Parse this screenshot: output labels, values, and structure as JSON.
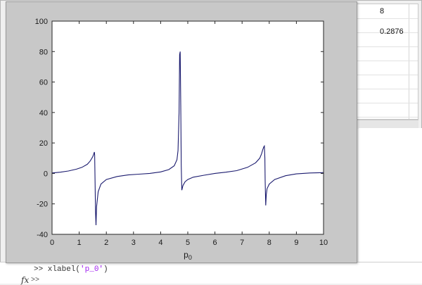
{
  "workspace": {
    "value_1": "8",
    "value_2": "0.2876"
  },
  "command_window": {
    "line_prefix": ">> xlabel(",
    "line_arg": "'p_0'",
    "line_suffix": ")",
    "fx_symbol": "fx",
    "prompt": ">>"
  },
  "chart_data": {
    "type": "line",
    "title": "",
    "xlabel_main": "p",
    "xlabel_sub": "0",
    "ylabel": "",
    "xlim": [
      0,
      10
    ],
    "ylim": [
      -40,
      100
    ],
    "xticks": [
      0,
      1,
      2,
      3,
      4,
      5,
      6,
      7,
      8,
      9,
      10
    ],
    "yticks": [
      -40,
      -20,
      0,
      20,
      40,
      60,
      80,
      100
    ],
    "grid": false,
    "series": [
      {
        "color": "#1a1a6e",
        "x": [
          0,
          0.3,
          0.6,
          0.9,
          1.1,
          1.3,
          1.4,
          1.45,
          1.5,
          1.53,
          1.56,
          1.57,
          1.6,
          1.62,
          1.64,
          1.7,
          1.8,
          2.0,
          2.4,
          2.8,
          3.2,
          3.6,
          4.0,
          4.3,
          4.5,
          4.6,
          4.64,
          4.68,
          4.7,
          4.72,
          4.74,
          4.76,
          4.78,
          4.82,
          4.9,
          5.0,
          5.2,
          5.6,
          6.0,
          6.4,
          6.8,
          7.2,
          7.5,
          7.65,
          7.72,
          7.76,
          7.8,
          7.82,
          7.84,
          7.85,
          7.87,
          7.89,
          7.92,
          8.0,
          8.2,
          8.6,
          9.0,
          9.5,
          10.0
        ],
        "y": [
          0.3,
          0.8,
          1.6,
          2.8,
          4.0,
          6.0,
          8.0,
          9.5,
          11.0,
          12.5,
          14.0,
          12.0,
          -25.0,
          -34.0,
          -22.0,
          -12.0,
          -7.0,
          -4.0,
          -2.0,
          -1.0,
          -0.5,
          0.0,
          1.0,
          2.5,
          5.0,
          9.0,
          15.0,
          40.0,
          78.0,
          80.0,
          45.0,
          5.0,
          -11.0,
          -8.0,
          -5.5,
          -4.0,
          -2.5,
          -1.2,
          0.0,
          0.8,
          1.8,
          4.0,
          7.0,
          10.0,
          13.0,
          15.5,
          17.5,
          18.0,
          10.0,
          -5.0,
          -21.0,
          -14.0,
          -10.0,
          -7.0,
          -4.0,
          -1.5,
          -0.3,
          0.3,
          0.5
        ]
      }
    ]
  }
}
